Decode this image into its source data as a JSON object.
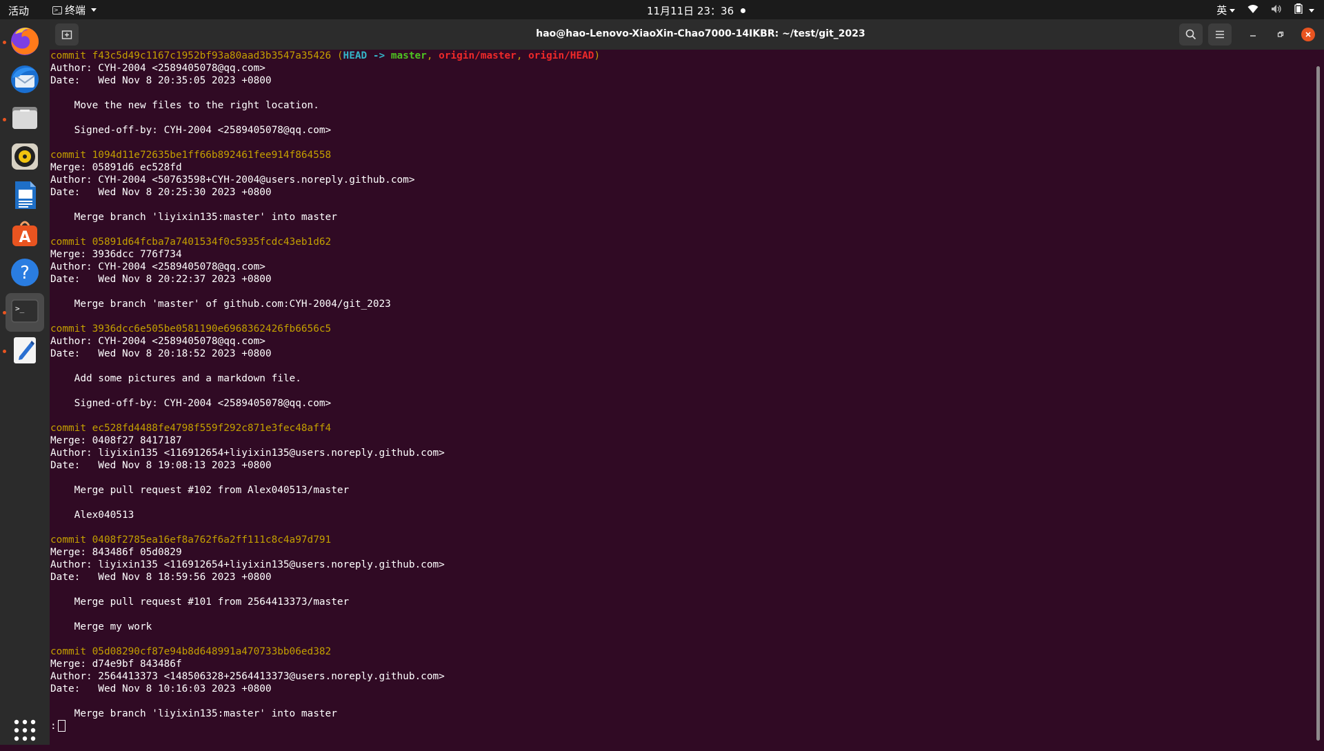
{
  "topbar": {
    "activities": "活动",
    "app_name": "终端",
    "clock": "11月11日  23：36",
    "input_method": "英"
  },
  "dock": {
    "items": [
      {
        "name": "firefox",
        "running": true
      },
      {
        "name": "thunderbird",
        "running": false
      },
      {
        "name": "files",
        "running": true
      },
      {
        "name": "rhythmbox",
        "running": false
      },
      {
        "name": "libreoffice-writer",
        "running": false
      },
      {
        "name": "ubuntu-software",
        "running": false
      },
      {
        "name": "help",
        "running": false
      },
      {
        "name": "terminal",
        "running": true,
        "active": true
      },
      {
        "name": "text-editor",
        "running": true
      }
    ],
    "apps_grid": "show-applications"
  },
  "window": {
    "title": "hao@hao-Lenovo-XiaoXin-Chao7000-14IKBR: ~/test/git_2023"
  },
  "terminal": {
    "lines": [
      {
        "type": "head",
        "prefix": "commit f43c5d49c1167c1952bf93a80aad3b3547a35426 ",
        "open": "(",
        "head": "HEAD -> ",
        "branch": "master",
        "sep1": ", ",
        "remote1": "origin/master",
        "sep2": ", ",
        "remote2": "origin/HEAD",
        "close": ")"
      },
      {
        "type": "text",
        "text": "Author: CYH-2004 <2589405078@qq.com>"
      },
      {
        "type": "text",
        "text": "Date:   Wed Nov 8 20:35:05 2023 +0800"
      },
      {
        "type": "text",
        "text": ""
      },
      {
        "type": "text",
        "text": "    Move the new files to the right location."
      },
      {
        "type": "text",
        "text": ""
      },
      {
        "type": "text",
        "text": "    Signed-off-by: CYH-2004 <2589405078@qq.com>"
      },
      {
        "type": "text",
        "text": ""
      },
      {
        "type": "commit",
        "text": "commit 1094d11e72635be1ff66b892461fee914f864558"
      },
      {
        "type": "text",
        "text": "Merge: 05891d6 ec528fd"
      },
      {
        "type": "text",
        "text": "Author: CYH-2004 <50763598+CYH-2004@users.noreply.github.com>"
      },
      {
        "type": "text",
        "text": "Date:   Wed Nov 8 20:25:30 2023 +0800"
      },
      {
        "type": "text",
        "text": ""
      },
      {
        "type": "text",
        "text": "    Merge branch 'liyixin135:master' into master"
      },
      {
        "type": "text",
        "text": ""
      },
      {
        "type": "commit",
        "text": "commit 05891d64fcba7a7401534f0c5935fcdc43eb1d62"
      },
      {
        "type": "text",
        "text": "Merge: 3936dcc 776f734"
      },
      {
        "type": "text",
        "text": "Author: CYH-2004 <2589405078@qq.com>"
      },
      {
        "type": "text",
        "text": "Date:   Wed Nov 8 20:22:37 2023 +0800"
      },
      {
        "type": "text",
        "text": ""
      },
      {
        "type": "text",
        "text": "    Merge branch 'master' of github.com:CYH-2004/git_2023"
      },
      {
        "type": "text",
        "text": ""
      },
      {
        "type": "commit",
        "text": "commit 3936dcc6e505be0581190e6968362426fb6656c5"
      },
      {
        "type": "text",
        "text": "Author: CYH-2004 <2589405078@qq.com>"
      },
      {
        "type": "text",
        "text": "Date:   Wed Nov 8 20:18:52 2023 +0800"
      },
      {
        "type": "text",
        "text": ""
      },
      {
        "type": "text",
        "text": "    Add some pictures and a markdown file."
      },
      {
        "type": "text",
        "text": ""
      },
      {
        "type": "text",
        "text": "    Signed-off-by: CYH-2004 <2589405078@qq.com>"
      },
      {
        "type": "text",
        "text": ""
      },
      {
        "type": "commit",
        "text": "commit ec528fd4488fe4798f559f292c871e3fec48aff4"
      },
      {
        "type": "text",
        "text": "Merge: 0408f27 8417187"
      },
      {
        "type": "text",
        "text": "Author: liyixin135 <116912654+liyixin135@users.noreply.github.com>"
      },
      {
        "type": "text",
        "text": "Date:   Wed Nov 8 19:08:13 2023 +0800"
      },
      {
        "type": "text",
        "text": ""
      },
      {
        "type": "text",
        "text": "    Merge pull request #102 from Alex040513/master"
      },
      {
        "type": "text",
        "text": ""
      },
      {
        "type": "text",
        "text": "    Alex040513"
      },
      {
        "type": "text",
        "text": ""
      },
      {
        "type": "commit",
        "text": "commit 0408f2785ea16ef8a762f6a2ff111c8c4a97d791"
      },
      {
        "type": "text",
        "text": "Merge: 843486f 05d0829"
      },
      {
        "type": "text",
        "text": "Author: liyixin135 <116912654+liyixin135@users.noreply.github.com>"
      },
      {
        "type": "text",
        "text": "Date:   Wed Nov 8 18:59:56 2023 +0800"
      },
      {
        "type": "text",
        "text": ""
      },
      {
        "type": "text",
        "text": "    Merge pull request #101 from 2564413373/master"
      },
      {
        "type": "text",
        "text": ""
      },
      {
        "type": "text",
        "text": "    Merge my work"
      },
      {
        "type": "text",
        "text": ""
      },
      {
        "type": "commit",
        "text": "commit 05d08290cf87e94b8d648991a470733bb06ed382"
      },
      {
        "type": "text",
        "text": "Merge: d74e9bf 843486f"
      },
      {
        "type": "text",
        "text": "Author: 2564413373 <148506328+2564413373@users.noreply.github.com>"
      },
      {
        "type": "text",
        "text": "Date:   Wed Nov 8 10:16:03 2023 +0800"
      },
      {
        "type": "text",
        "text": ""
      },
      {
        "type": "text",
        "text": "    Merge branch 'liyixin135:master' into master"
      }
    ],
    "prompt": ":"
  },
  "colors": {
    "terminal_bg": "#300a24",
    "commit_yellow": "#c4a000",
    "head_cyan": "#34b5c9",
    "branch_green": "#4ec421",
    "remote_red": "#ef2929",
    "accent_orange": "#e95420"
  }
}
